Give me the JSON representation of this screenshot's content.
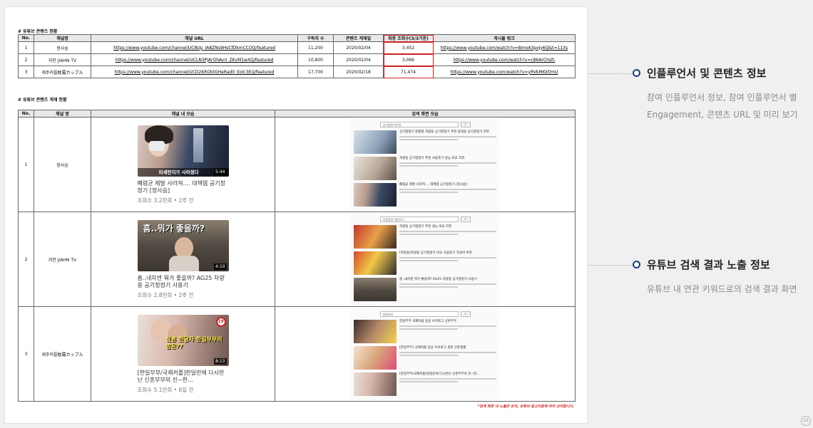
{
  "section1": {
    "title": "# 유튜브 콘텐츠 현황",
    "headers": [
      "No.",
      "채널명",
      "채널 URL",
      "구독자 수",
      "콘텐츠 게재일",
      "최종 조회수(3/3기준)",
      "게시물 링크"
    ],
    "rows": [
      {
        "no": "1",
        "channel": "정사슴",
        "url": "https://www.youtube.com/channel/UC8Up_IA8ZNs9HsCfDkmCCOQ/featured",
        "subs": "11,200",
        "date": "2020/02/04",
        "views": "3,452",
        "link": "https://www.youtube.com/watch?v=BmoA3pxJy6Q&t=113s"
      },
      {
        "no": "2",
        "channel": "지안 JIAHN TV",
        "url": "https://www.youtube.com/channel/UCLN3PJArOhAvri_ZKvM1wXQ/featured",
        "subs": "10,800",
        "date": "2020/02/04",
        "views": "3,066",
        "link": "https://www.youtube.com/watch?v=c86ArChsfc"
      },
      {
        "no": "3",
        "channel": "제주커플耽羅カップル",
        "url": "https://www.youtube.com/channel/UCD2KROktGHeRad0_Eolc3EQ/featured",
        "subs": "17,700",
        "date": "2020/02/18",
        "views": "71,474",
        "link": "https://www.youtube.com/watch?v=yRVkMKkf/mU"
      }
    ]
  },
  "section2": {
    "title": "# 유튜브 콘텐츠 게재 현황",
    "headers": [
      "No.",
      "채널 명",
      "채널 내 모습",
      "검색 화면 모습"
    ],
    "rows": [
      {
        "no": "1",
        "channel": "정사슴",
        "thumb_caption": "미세먼지가 사라졌다",
        "duration": "5:44",
        "video_title": "폐렴균 제발 사라져.... 대책템 공기청정기 [정사슴]",
        "video_meta": "조회수 3.2천회 • 2주 전",
        "search_query": "공기청정기추천",
        "results": [
          "공기청정기 끝판왕 차량용 공기청정기 추천 휴대용 공기청정기 리뷰",
          "차량용 공기청정기 추천 사용후기 성능 비교 리뷰",
          "폐렴균 제발 사라져.... 대책템 공기청정기 [정사슴]"
        ]
      },
      {
        "no": "2",
        "channel": "지안 JIAHN TV",
        "thumb_caption": "흠..뭐가 좋을까?",
        "duration": "4:10",
        "video_title": "흠..내차엔 뭐가 좋을까? AG25 차량용 공기청정기 사용기",
        "video_meta": "조회수 2.8천회 • 2주 전",
        "search_query": "차량용공기청정기",
        "results": [
          "차량용 공기청정기 추천 성능 비교 리뷰",
          "[차량용]차량용 공기청정기 비교 사용후기 가성비 추천",
          "흠..내차엔 뭐가 좋을까? AG25 차량용 공기청정기 사용기"
        ]
      },
      {
        "no": "3",
        "channel": "제주커플耽羅カップル",
        "thumb_caption": "신혼 한달차 한일부부의 밤은??",
        "duration": "8:13",
        "video_title": "[한일부부/국제커플]한일만에 다시만난 신혼부부의 진~한...",
        "video_meta": "조회수 5.1만회 • 6일 전",
        "search_query": "한일부부",
        "results": [
          "한일부부 국제커플 일상 브이로그 신혼부부",
          "[한일부부] 국제커플 일상 브이로그 결혼 신혼생활",
          "[한일부부/국제커플]한일만에 다시만난 신혼부부의 진~한..."
        ]
      }
    ],
    "footnote": "*검색 화면 내 노출은 유저, 유튜브 알고리즘에 따라 상이합니다."
  },
  "right_panel": {
    "items": [
      {
        "title": "인플루언서 및 콘텐츠 정보",
        "desc_line1": "참여 인플루언서 정보, 참여 인플루언서 별",
        "desc_line2": "Engagement, 콘텐츠 URL 및 미리 보기"
      },
      {
        "title": "유튜브 검색 결과 노출 정보",
        "desc_line1": "유튜브 내 연관 키워드로의 검색 결과 화면"
      }
    ],
    "accent": "#1d3a7a"
  },
  "page_number": "22"
}
